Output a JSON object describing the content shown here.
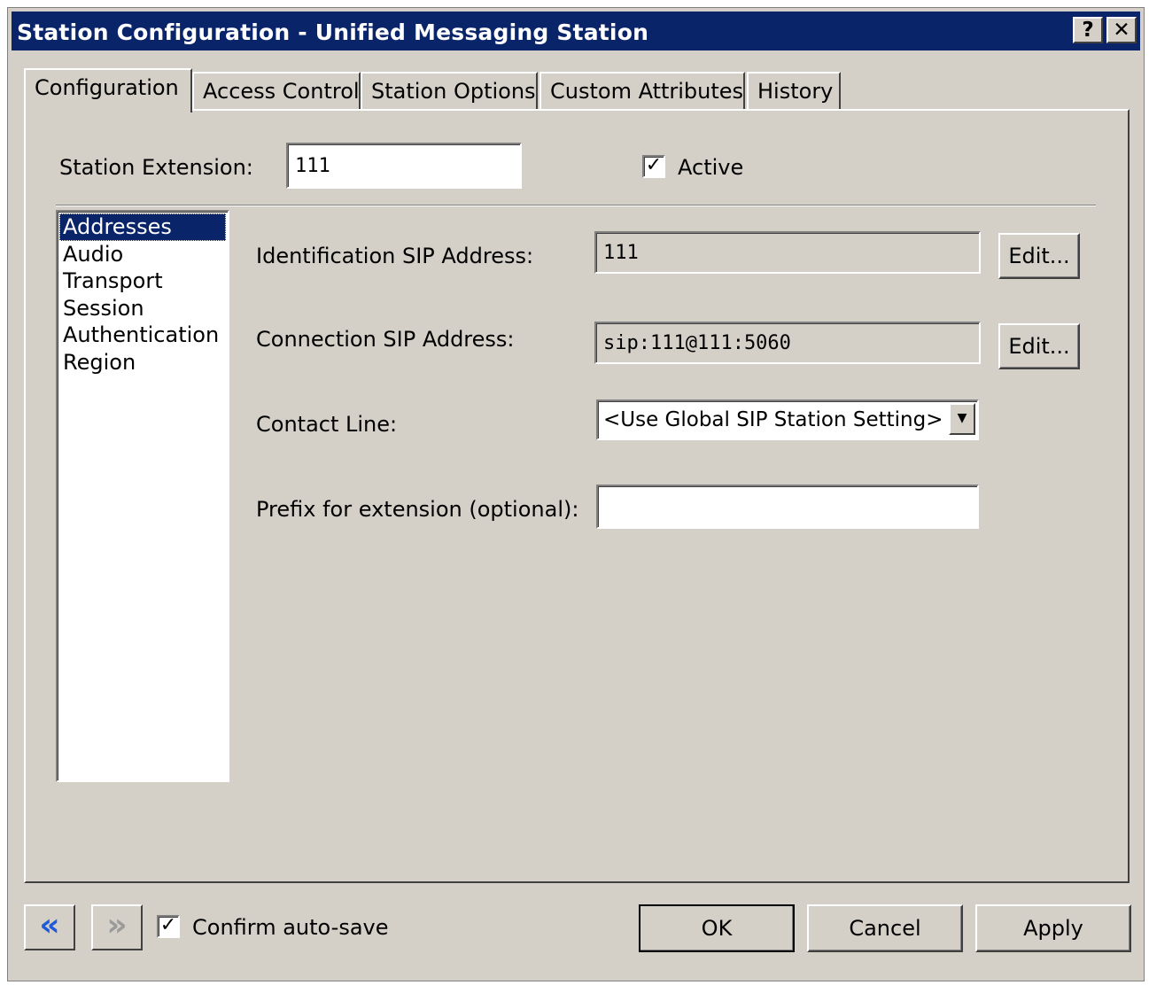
{
  "window": {
    "title": "Station Configuration - Unified Messaging Station",
    "help_label": "?",
    "close_label": "✕"
  },
  "tabs": [
    {
      "label": "Configuration",
      "active": true
    },
    {
      "label": "Access Control",
      "active": false
    },
    {
      "label": "Station Options",
      "active": false
    },
    {
      "label": "Custom Attributes",
      "active": false
    },
    {
      "label": "History",
      "active": false
    }
  ],
  "config": {
    "station_extension_label": "Station Extension:",
    "station_extension_value": "111",
    "active_label": "Active",
    "active_checked": true
  },
  "categories": {
    "items": [
      "Addresses",
      "Audio",
      "Transport",
      "Session",
      "Authentication",
      "Region"
    ],
    "selected": "Addresses"
  },
  "addresses": {
    "identification_label": "Identification SIP Address:",
    "identification_value": "111",
    "identification_edit": "Edit...",
    "connection_label": "Connection SIP Address:",
    "connection_value": "sip:111@111:5060",
    "connection_edit": "Edit...",
    "contact_line_label": "Contact Line:",
    "contact_line_value": "<Use Global SIP Station Setting>",
    "prefix_label": "Prefix for extension (optional):",
    "prefix_value": ""
  },
  "footer": {
    "back_icon": "«",
    "forward_icon": "»",
    "confirm_autosave_label": "Confirm auto-save",
    "confirm_autosave_checked": true,
    "ok_label": "OK",
    "cancel_label": "Cancel",
    "apply_label": "Apply"
  },
  "colors": {
    "titlebar": "#0a246a",
    "dialog_bg": "#d4d0c8",
    "back_arrow": "#1e5bd8",
    "forward_arrow_disabled": "#9a9a9a"
  }
}
